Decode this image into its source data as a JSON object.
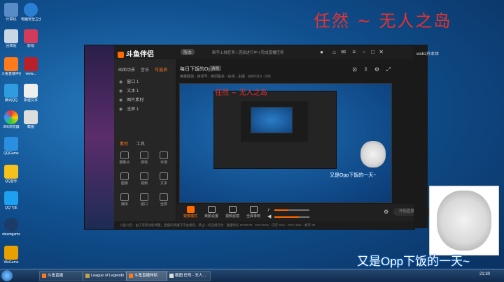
{
  "desktop": {
    "overlay_title": "任然 ~ 无人之岛",
    "caption": "又是Opp下饭的一天~",
    "icons": [
      {
        "label": "计算机"
      },
      {
        "label": "电脑安全卫士"
      },
      {
        "label": "回收站"
      },
      {
        "label": "影视"
      },
      {
        "label": "斗鱼直播伴侣"
      },
      {
        "label": "www..."
      },
      {
        "label": "腾讯QQ"
      },
      {
        "label": "新建文本"
      },
      {
        "label": "360浏览器"
      },
      {
        "label": "截图"
      },
      {
        "label": "QQGame"
      },
      {
        "label": "QQ音乐"
      },
      {
        "label": "QQ飞车"
      },
      {
        "label": "steamgame"
      },
      {
        "label": "WeGame"
      }
    ],
    "right_strip_text": "webz开本体"
  },
  "obs": {
    "app_name": "斗鱼伴侣",
    "version_pill": "版本",
    "news": "新手上线任务 | 活动进行中 | 完成直播任务",
    "source_tabs": {
      "tab1": "画面场景",
      "tab2": "音乐",
      "tab3": "可选项"
    },
    "sources": [
      {
        "label": "窗口 1"
      },
      {
        "label": "文本 1"
      },
      {
        "label": "图片素材"
      },
      {
        "label": "全屏 1"
      }
    ],
    "panel_tabs": {
      "tab1": "素材",
      "tab2": "工具"
    },
    "tools": [
      {
        "label": "摄像头"
      },
      {
        "label": "游戏"
      },
      {
        "label": "手游"
      },
      {
        "label": "图像"
      },
      {
        "label": "视频"
      },
      {
        "label": "文本"
      },
      {
        "label": "媒体"
      },
      {
        "label": "窗口"
      },
      {
        "label": "全屏"
      }
    ],
    "room_title": "每日下饭的Opp",
    "room_tag": "游戏",
    "info_line": "英雄联盟 · 房间号 · 房间最多 · 在线 · 主播 · 6097010 · 290",
    "preview_overlay_text": "任然 ~ 无人之岛",
    "preview_caption": "又是Opp下饭的一天~",
    "controls": [
      {
        "label": "镜像模式"
      },
      {
        "label": "美颜设置"
      },
      {
        "label": "视频滤镜"
      },
      {
        "label": "全屏录制"
      }
    ],
    "btn_live": "开始直播",
    "btn_record": "录制",
    "status": "斗鱼公告：由于近期功能调整，直播间请遵守平台规则，禁止一切违规行为 · 直播时长 00:00:00 · CPU 22% · 内存 42% · CPU 13% · 帧率 30"
  },
  "taskbar": {
    "items": [
      {
        "label": "斗鱼直播"
      },
      {
        "label": "League of Legends"
      },
      {
        "label": "斗鱼直播伴侣"
      },
      {
        "label": "截图 任然 - 无人..."
      }
    ],
    "clock": "21:30"
  }
}
